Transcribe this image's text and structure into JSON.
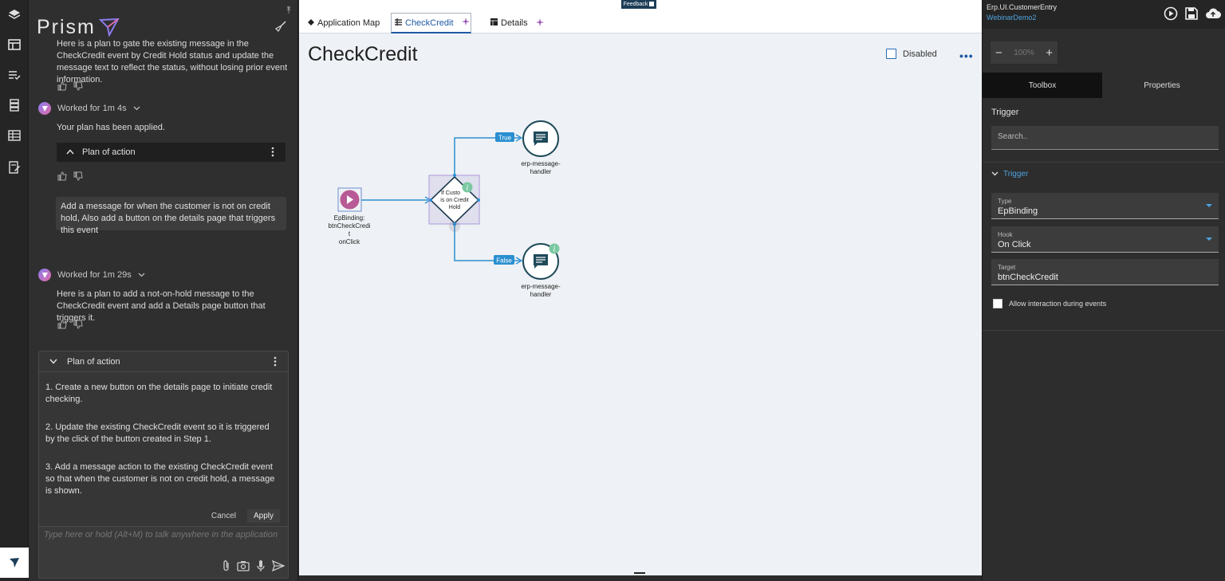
{
  "brand": "Prism",
  "chat": {
    "msg0": "Here is a plan to gate the existing message in the CheckCredit event by Credit Hold status and update the message text to reflect the status, without losing prior event information.",
    "worked1": "Worked for 1m 4s",
    "msg1": "Your plan has been applied.",
    "plan_collapsed": "Plan of action",
    "user_msg": "Add a message for when the customer is not on credit hold, Also add a button on the details page that triggers this event",
    "worked2": "Worked for 1m 29s",
    "msg2": "Here is a plan to add a not-on-hold message to the CheckCredit event and add a Details page button that triggers it.",
    "plan_title": "Plan of action",
    "steps": [
      "1. Create a new button on the details page to initiate credit checking.",
      "2. Update the existing CheckCredit event so it is triggered by the click of the button created in Step 1.",
      "3. Add a message action to the existing CheckCredit event so that when the customer is not on credit hold, a message is shown."
    ],
    "cancel": "Cancel",
    "apply": "Apply",
    "input_placeholder": "Type here or hold (Alt+M) to talk anywhere in the application"
  },
  "center": {
    "feedback": "Feedback",
    "tabs": [
      {
        "label": "Application Map"
      },
      {
        "label": "CheckCredit"
      },
      {
        "label": "Details"
      }
    ],
    "title": "CheckCredit",
    "disabled_label": "Disabled",
    "more": "•••",
    "flow": {
      "trigger_label": [
        "EpBinding:",
        "btnCheckCredi",
        "t",
        "onClick"
      ],
      "decision_label": [
        "If Custo",
        "is on Credit",
        "Hold"
      ],
      "true_label": "True",
      "false_label": "False",
      "handler_label": [
        "erp-message-",
        "handler"
      ]
    }
  },
  "right": {
    "title": "Erp.UI.CustomerEntry",
    "subtitle": "WebinarDemo2",
    "zoom": "100%",
    "tabs": [
      "Toolbox",
      "Properties"
    ],
    "section": "Trigger",
    "search_placeholder": "Search..",
    "trigger_head": "Trigger",
    "type_label": "Type",
    "type_value": "EpBinding",
    "hook_label": "Hook",
    "hook_value": "On Click",
    "target_label": "Target",
    "target_value": "btnCheckCredit",
    "allow_label": "Allow interaction during events"
  },
  "colors": {
    "accent": "#1f5aa6",
    "link": "#4fa3e0",
    "trigger_node": "#b85a95",
    "handler_stroke": "#1f4a5a",
    "flow_line": "#2a8fd0",
    "info_badge": "#7cc8a2"
  }
}
